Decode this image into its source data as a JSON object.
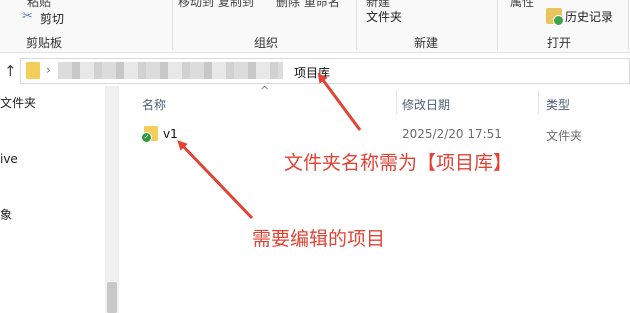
{
  "ribbon": {
    "top_cut_labels": [
      "粘贴",
      "移动到 复制到",
      "删除 重命名",
      "新建",
      "属性"
    ],
    "cut_label": "剪切",
    "new_folder_label": "文件夹",
    "history_label": "历史记录",
    "groups": [
      "剪贴板",
      "组织",
      "新建",
      "打开"
    ]
  },
  "address": {
    "current_folder": "项目库"
  },
  "nav": {
    "items": [
      "文件夹",
      "ive",
      "象"
    ]
  },
  "columns": {
    "name": "名称",
    "modified": "修改日期",
    "type": "类型"
  },
  "files": [
    {
      "name": "v1",
      "modified": "2025/2/20 17:51",
      "type": "文件夹"
    }
  ],
  "annotations": {
    "folder_note": "文件夹名称需为【项目库】",
    "item_note": "需要编辑的项目",
    "color": "#e34234"
  }
}
